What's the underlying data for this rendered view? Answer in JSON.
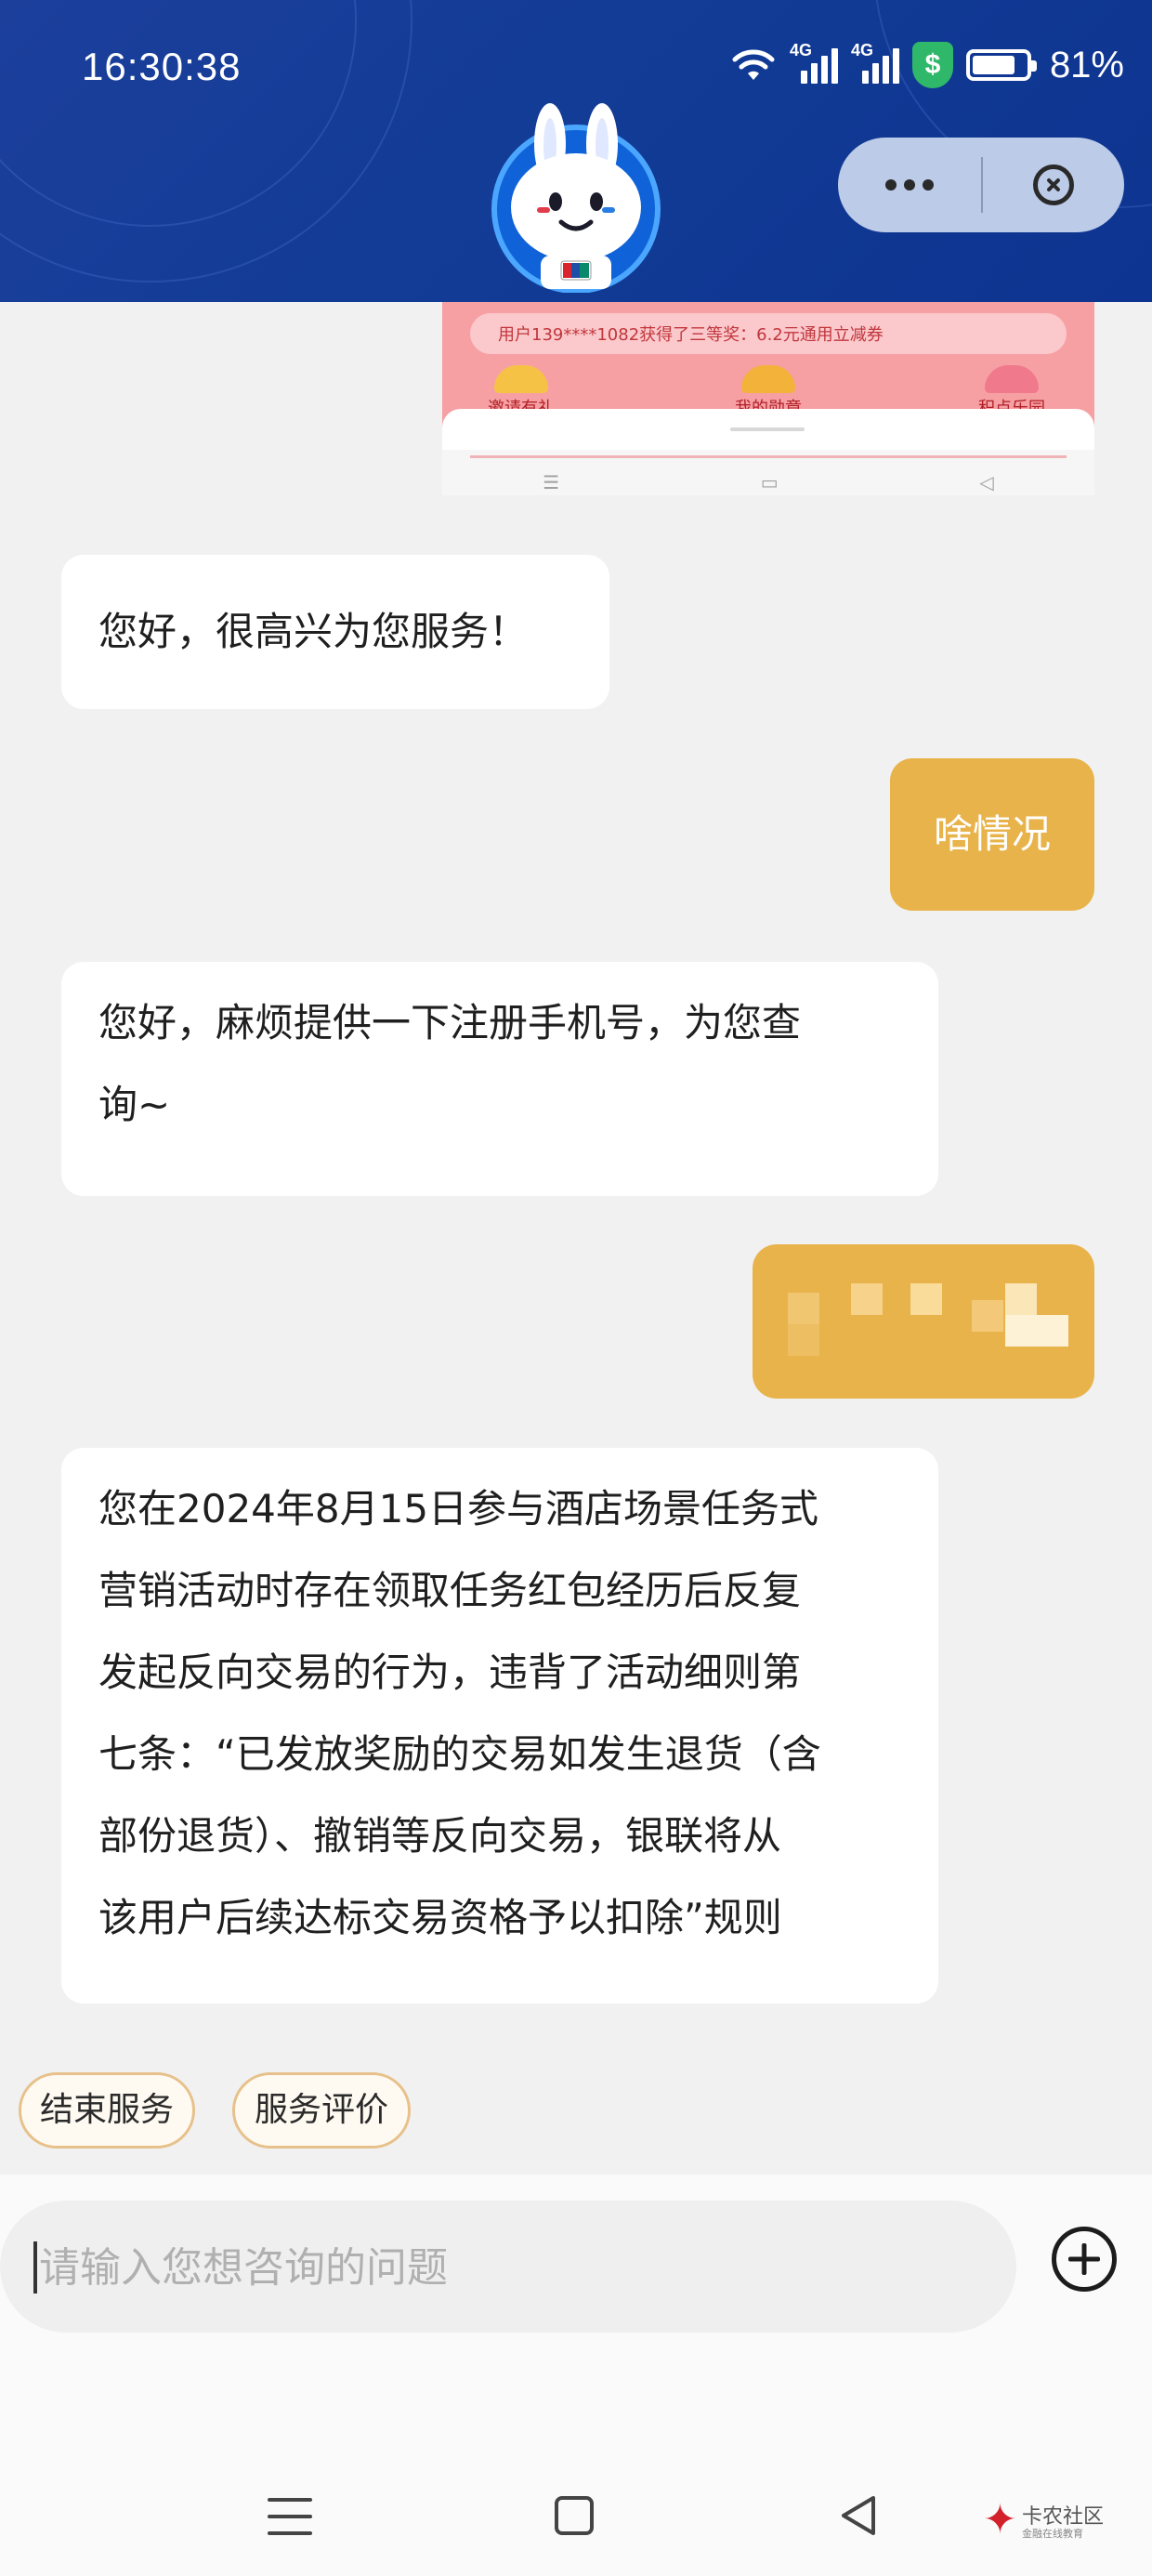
{
  "status_bar": {
    "time": "16:30:38",
    "network_label_1": "4G",
    "network_label_2": "4G",
    "shield_symbol": "$",
    "battery_percent": "81%",
    "battery_level": 0.81
  },
  "header": {
    "bg_color": "#123c96",
    "more_button": "more-dots-icon",
    "close_button": "close-circle-icon",
    "mascot": "rabbit-mascot-avatar"
  },
  "shared_screenshot": {
    "ticker_text": "用户139****1082获得了三等奖：6.2元通用立减券",
    "features": [
      "邀请有礼",
      "我的勋章",
      "积点乐园"
    ]
  },
  "messages": [
    {
      "from": "agent",
      "text": "您好，很高兴为您服务！"
    },
    {
      "from": "user",
      "text": "啥情况"
    },
    {
      "from": "agent",
      "lines": [
        "您好，麻烦提供一下注册手机号，为您查",
        "询~"
      ]
    },
    {
      "from": "user",
      "redacted": true
    },
    {
      "from": "agent",
      "lines": [
        "您在2024年8月15日参与酒店场景任务式",
        "营销活动时存在领取任务红包经历后反复",
        "发起反向交易的行为，违背了活动细则第",
        "七条：“已发放奖励的交易如发生退货（含",
        "部份退货）、撤销等反向交易，银联将从",
        "该用户后续达标交易资格予以扣除”规则"
      ]
    }
  ],
  "quick_actions": [
    "结束服务",
    "服务评价"
  ],
  "input": {
    "placeholder": "请输入您想咨询的问题",
    "value": ""
  },
  "watermark": {
    "title": "卡农社区",
    "subtitle": "金融在线教育"
  },
  "colors": {
    "accent": "#e8b34a",
    "chip_border": "#e7c18b",
    "header": "#123c96"
  }
}
